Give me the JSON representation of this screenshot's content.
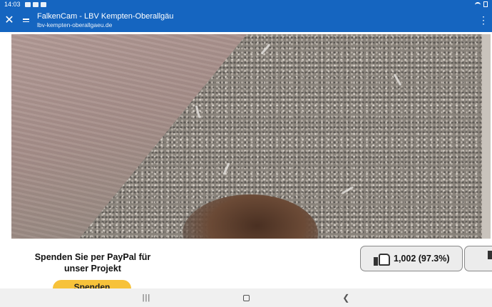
{
  "status_bar": {
    "time": "14:03"
  },
  "app_bar": {
    "title": "FalkenCam - LBV Kempten-Oberallgäu",
    "url": "lbv-kempten-oberallgaeu.de",
    "close_icon": "close-icon",
    "more_icon": "more-vert-icon"
  },
  "stream": {
    "description_icon": "camera-feed"
  },
  "donate": {
    "text": "Spenden Sie per PayPal für unser Projekt",
    "button_label": "Spenden"
  },
  "rating": {
    "likes": "1,002 (97.3%)"
  },
  "colors": {
    "app_bar": "#1565c0",
    "donate_button": "#f7c23a"
  }
}
